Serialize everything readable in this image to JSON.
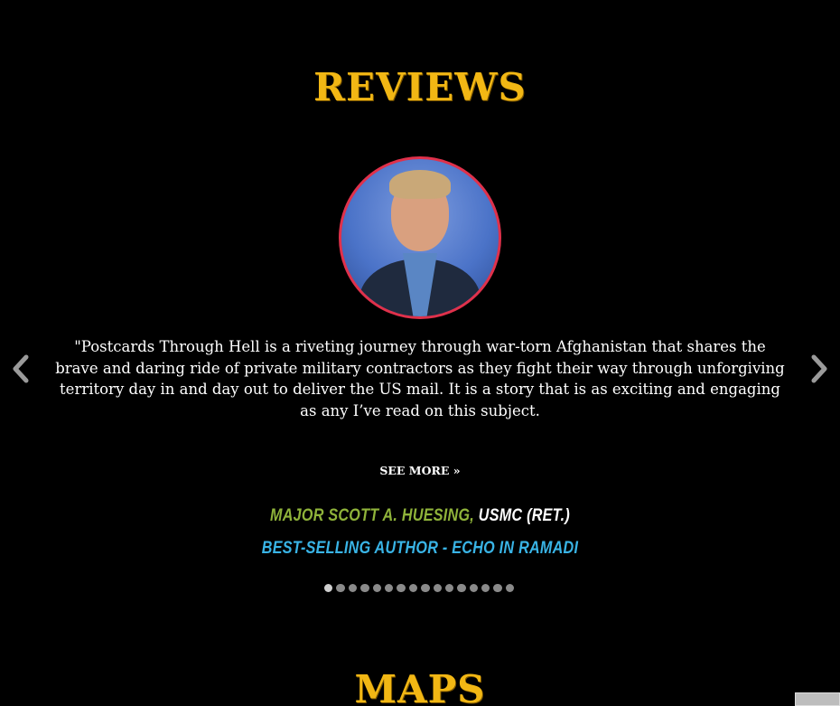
{
  "sections": {
    "reviews_title": "REVIEWS",
    "maps_title": "MAPS"
  },
  "review": {
    "quote": "\"Postcards Through Hell is a riveting journey through war-torn Afghanistan that shares the brave and daring ride of private military contractors as they fight their way through unforgiving territory day in and day out to deliver the US mail. It is a story that is as exciting and engaging as any I’ve read on this subject.",
    "see_more": "SEE MORE »",
    "reviewer_name": "MAJOR SCOTT A. HUESING,",
    "reviewer_rank": " USMC (RET.)",
    "reviewer_title": "BEST-SELLING AUTHOR - ECHO IN RAMADI"
  },
  "carousel": {
    "dot_count": 16,
    "active_index": 0
  },
  "colors": {
    "title_gold": "#f2b714",
    "avatar_border": "#e0314b",
    "name_green": "#8fb33a",
    "title_blue": "#39b4e6"
  },
  "icons": {
    "prev": "chevron-left-icon",
    "next": "chevron-right-icon"
  }
}
